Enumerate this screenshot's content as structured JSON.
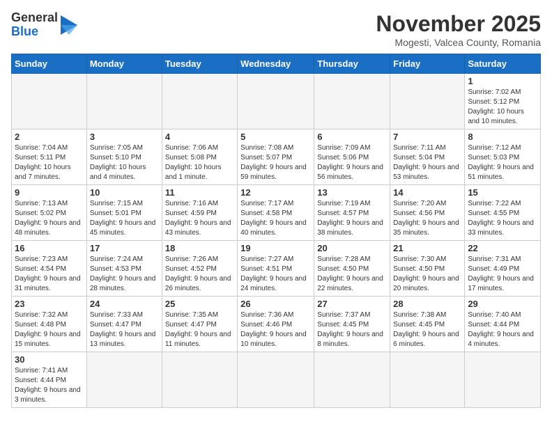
{
  "header": {
    "logo_general": "General",
    "logo_blue": "Blue",
    "month_title": "November 2025",
    "location": "Mogesti, Valcea County, Romania"
  },
  "columns": [
    "Sunday",
    "Monday",
    "Tuesday",
    "Wednesday",
    "Thursday",
    "Friday",
    "Saturday"
  ],
  "days": [
    {
      "row": 0,
      "cells": [
        {
          "num": "",
          "info": "",
          "empty": true
        },
        {
          "num": "",
          "info": "",
          "empty": true
        },
        {
          "num": "",
          "info": "",
          "empty": true
        },
        {
          "num": "",
          "info": "",
          "empty": true
        },
        {
          "num": "",
          "info": "",
          "empty": true
        },
        {
          "num": "",
          "info": "",
          "empty": true
        },
        {
          "num": "1",
          "info": "Sunrise: 7:02 AM\nSunset: 5:12 PM\nDaylight: 10 hours and 10 minutes.",
          "empty": false
        }
      ]
    },
    {
      "row": 1,
      "cells": [
        {
          "num": "2",
          "info": "Sunrise: 7:04 AM\nSunset: 5:11 PM\nDaylight: 10 hours and 7 minutes.",
          "empty": false
        },
        {
          "num": "3",
          "info": "Sunrise: 7:05 AM\nSunset: 5:10 PM\nDaylight: 10 hours and 4 minutes.",
          "empty": false
        },
        {
          "num": "4",
          "info": "Sunrise: 7:06 AM\nSunset: 5:08 PM\nDaylight: 10 hours and 1 minute.",
          "empty": false
        },
        {
          "num": "5",
          "info": "Sunrise: 7:08 AM\nSunset: 5:07 PM\nDaylight: 9 hours and 59 minutes.",
          "empty": false
        },
        {
          "num": "6",
          "info": "Sunrise: 7:09 AM\nSunset: 5:06 PM\nDaylight: 9 hours and 56 minutes.",
          "empty": false
        },
        {
          "num": "7",
          "info": "Sunrise: 7:11 AM\nSunset: 5:04 PM\nDaylight: 9 hours and 53 minutes.",
          "empty": false
        },
        {
          "num": "8",
          "info": "Sunrise: 7:12 AM\nSunset: 5:03 PM\nDaylight: 9 hours and 51 minutes.",
          "empty": false
        }
      ]
    },
    {
      "row": 2,
      "cells": [
        {
          "num": "9",
          "info": "Sunrise: 7:13 AM\nSunset: 5:02 PM\nDaylight: 9 hours and 48 minutes.",
          "empty": false
        },
        {
          "num": "10",
          "info": "Sunrise: 7:15 AM\nSunset: 5:01 PM\nDaylight: 9 hours and 45 minutes.",
          "empty": false
        },
        {
          "num": "11",
          "info": "Sunrise: 7:16 AM\nSunset: 4:59 PM\nDaylight: 9 hours and 43 minutes.",
          "empty": false
        },
        {
          "num": "12",
          "info": "Sunrise: 7:17 AM\nSunset: 4:58 PM\nDaylight: 9 hours and 40 minutes.",
          "empty": false
        },
        {
          "num": "13",
          "info": "Sunrise: 7:19 AM\nSunset: 4:57 PM\nDaylight: 9 hours and 38 minutes.",
          "empty": false
        },
        {
          "num": "14",
          "info": "Sunrise: 7:20 AM\nSunset: 4:56 PM\nDaylight: 9 hours and 35 minutes.",
          "empty": false
        },
        {
          "num": "15",
          "info": "Sunrise: 7:22 AM\nSunset: 4:55 PM\nDaylight: 9 hours and 33 minutes.",
          "empty": false
        }
      ]
    },
    {
      "row": 3,
      "cells": [
        {
          "num": "16",
          "info": "Sunrise: 7:23 AM\nSunset: 4:54 PM\nDaylight: 9 hours and 31 minutes.",
          "empty": false
        },
        {
          "num": "17",
          "info": "Sunrise: 7:24 AM\nSunset: 4:53 PM\nDaylight: 9 hours and 28 minutes.",
          "empty": false
        },
        {
          "num": "18",
          "info": "Sunrise: 7:26 AM\nSunset: 4:52 PM\nDaylight: 9 hours and 26 minutes.",
          "empty": false
        },
        {
          "num": "19",
          "info": "Sunrise: 7:27 AM\nSunset: 4:51 PM\nDaylight: 9 hours and 24 minutes.",
          "empty": false
        },
        {
          "num": "20",
          "info": "Sunrise: 7:28 AM\nSunset: 4:50 PM\nDaylight: 9 hours and 22 minutes.",
          "empty": false
        },
        {
          "num": "21",
          "info": "Sunrise: 7:30 AM\nSunset: 4:50 PM\nDaylight: 9 hours and 20 minutes.",
          "empty": false
        },
        {
          "num": "22",
          "info": "Sunrise: 7:31 AM\nSunset: 4:49 PM\nDaylight: 9 hours and 17 minutes.",
          "empty": false
        }
      ]
    },
    {
      "row": 4,
      "cells": [
        {
          "num": "23",
          "info": "Sunrise: 7:32 AM\nSunset: 4:48 PM\nDaylight: 9 hours and 15 minutes.",
          "empty": false
        },
        {
          "num": "24",
          "info": "Sunrise: 7:33 AM\nSunset: 4:47 PM\nDaylight: 9 hours and 13 minutes.",
          "empty": false
        },
        {
          "num": "25",
          "info": "Sunrise: 7:35 AM\nSunset: 4:47 PM\nDaylight: 9 hours and 11 minutes.",
          "empty": false
        },
        {
          "num": "26",
          "info": "Sunrise: 7:36 AM\nSunset: 4:46 PM\nDaylight: 9 hours and 10 minutes.",
          "empty": false
        },
        {
          "num": "27",
          "info": "Sunrise: 7:37 AM\nSunset: 4:45 PM\nDaylight: 9 hours and 8 minutes.",
          "empty": false
        },
        {
          "num": "28",
          "info": "Sunrise: 7:38 AM\nSunset: 4:45 PM\nDaylight: 9 hours and 6 minutes.",
          "empty": false
        },
        {
          "num": "29",
          "info": "Sunrise: 7:40 AM\nSunset: 4:44 PM\nDaylight: 9 hours and 4 minutes.",
          "empty": false
        }
      ]
    },
    {
      "row": 5,
      "cells": [
        {
          "num": "30",
          "info": "Sunrise: 7:41 AM\nSunset: 4:44 PM\nDaylight: 9 hours and 3 minutes.",
          "empty": false
        },
        {
          "num": "",
          "info": "",
          "empty": true
        },
        {
          "num": "",
          "info": "",
          "empty": true
        },
        {
          "num": "",
          "info": "",
          "empty": true
        },
        {
          "num": "",
          "info": "",
          "empty": true
        },
        {
          "num": "",
          "info": "",
          "empty": true
        },
        {
          "num": "",
          "info": "",
          "empty": true
        }
      ]
    }
  ]
}
